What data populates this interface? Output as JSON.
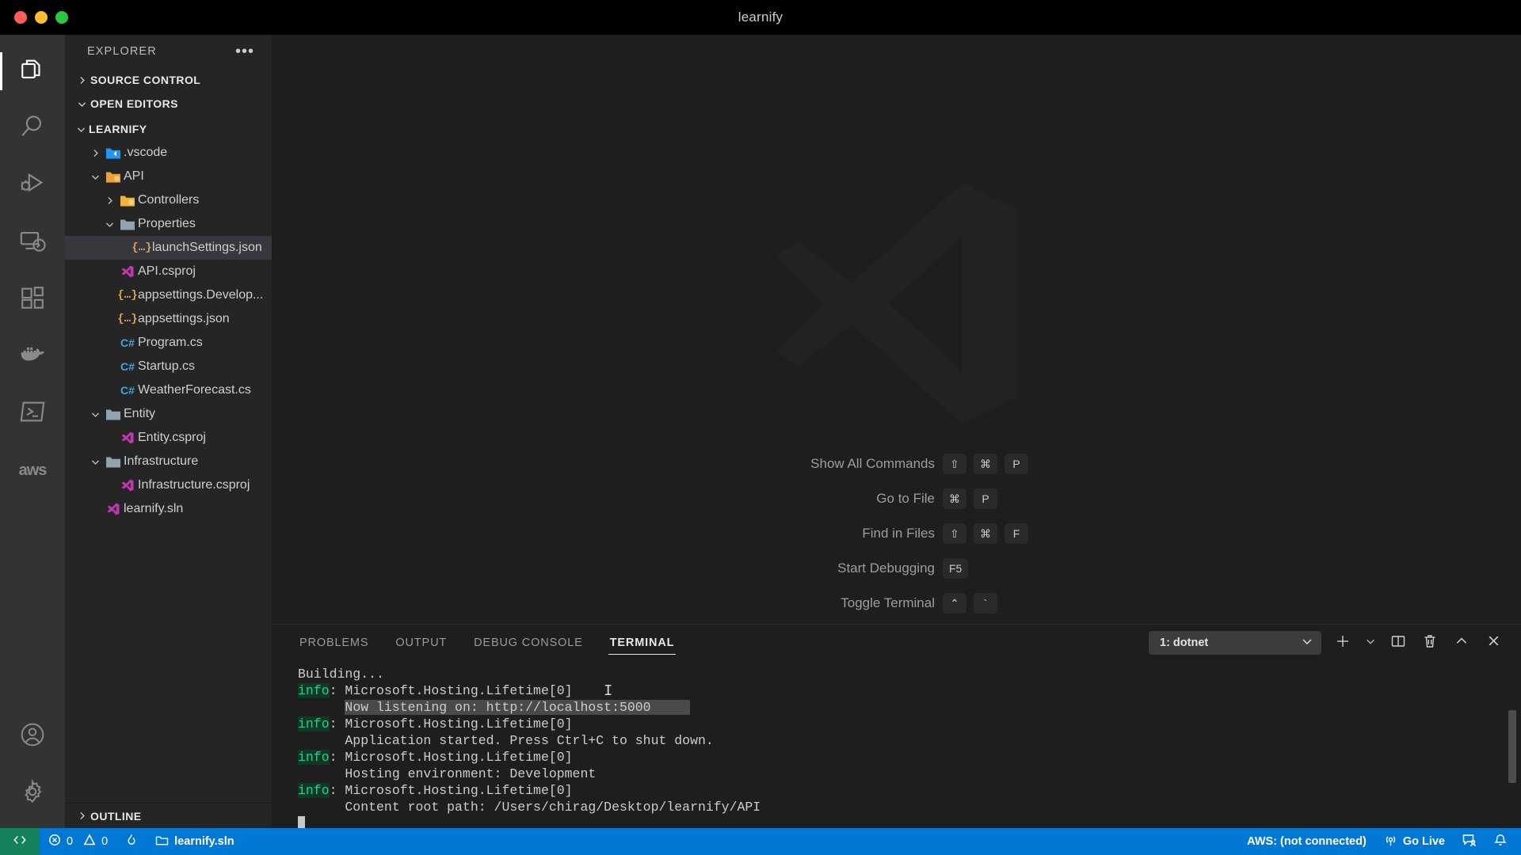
{
  "window": {
    "title": "learnify",
    "traffic_lights": [
      {
        "name": "close",
        "color": "#ff5f57"
      },
      {
        "name": "minimize",
        "color": "#febc2e"
      },
      {
        "name": "maximize",
        "color": "#28c840"
      }
    ]
  },
  "activitybar": {
    "items": [
      {
        "icon": "explorer-icon",
        "label": "Explorer",
        "active": true
      },
      {
        "icon": "search-icon",
        "label": "Search",
        "active": false
      },
      {
        "icon": "run-and-debug-icon",
        "label": "Run and Debug",
        "active": false
      },
      {
        "icon": "remote-explorer-icon",
        "label": "Remote Explorer",
        "active": false
      },
      {
        "icon": "extensions-icon",
        "label": "Extensions",
        "active": false
      },
      {
        "icon": "docker-icon",
        "label": "Docker",
        "active": false
      },
      {
        "icon": "terminal-powershell-icon",
        "label": "Azure Terminal",
        "active": false
      },
      {
        "icon": "aws-icon",
        "label": "aws",
        "active": false
      }
    ],
    "bottom_items": [
      {
        "icon": "account-icon",
        "label": "Accounts"
      },
      {
        "icon": "gear-icon",
        "label": "Manage"
      }
    ],
    "aws_text": "aws"
  },
  "sidebar": {
    "title": "EXPLORER",
    "more_actions": "•••",
    "sections": [
      {
        "label": "SOURCE CONTROL",
        "expanded": false
      },
      {
        "label": "OPEN EDITORS",
        "expanded": true
      }
    ],
    "outline_label": "OUTLINE",
    "tree": [
      {
        "label": "LEARNIFY",
        "indent": 0,
        "type": "root",
        "twisty": "down",
        "icon": "none",
        "selected": false,
        "bold": true
      },
      {
        "label": ".vscode",
        "indent": 1,
        "type": "folder",
        "twisty": "right",
        "icon": "folder-vscode-icon",
        "selected": false,
        "bold": false
      },
      {
        "label": "API",
        "indent": 1,
        "type": "folder",
        "twisty": "down",
        "icon": "folder-api-icon",
        "selected": false,
        "bold": false
      },
      {
        "label": "Controllers",
        "indent": 2,
        "type": "folder",
        "twisty": "right",
        "icon": "folder-controllers-icon",
        "selected": false,
        "bold": false
      },
      {
        "label": "Properties",
        "indent": 2,
        "type": "folder",
        "twisty": "down",
        "icon": "folder-properties-icon",
        "selected": false,
        "bold": false
      },
      {
        "label": "launchSettings.json",
        "indent": 3,
        "type": "file",
        "twisty": "none",
        "icon": "json-icon",
        "selected": true,
        "bold": false
      },
      {
        "label": "API.csproj",
        "indent": 2,
        "type": "file",
        "twisty": "none",
        "icon": "csproj-icon",
        "selected": false,
        "bold": false
      },
      {
        "label": "appsettings.Develop...",
        "indent": 2,
        "type": "file",
        "twisty": "none",
        "icon": "json-icon",
        "selected": false,
        "bold": false
      },
      {
        "label": "appsettings.json",
        "indent": 2,
        "type": "file",
        "twisty": "none",
        "icon": "json-icon",
        "selected": false,
        "bold": false
      },
      {
        "label": "Program.cs",
        "indent": 2,
        "type": "file",
        "twisty": "none",
        "icon": "csharp-icon",
        "selected": false,
        "bold": false
      },
      {
        "label": "Startup.cs",
        "indent": 2,
        "type": "file",
        "twisty": "none",
        "icon": "csharp-icon",
        "selected": false,
        "bold": false
      },
      {
        "label": "WeatherForecast.cs",
        "indent": 2,
        "type": "file",
        "twisty": "none",
        "icon": "csharp-icon",
        "selected": false,
        "bold": false
      },
      {
        "label": "Entity",
        "indent": 1,
        "type": "folder",
        "twisty": "down",
        "icon": "folder-icon",
        "selected": false,
        "bold": false
      },
      {
        "label": "Entity.csproj",
        "indent": 2,
        "type": "file",
        "twisty": "none",
        "icon": "csproj-icon",
        "selected": false,
        "bold": false
      },
      {
        "label": "Infrastructure",
        "indent": 1,
        "type": "folder",
        "twisty": "down",
        "icon": "folder-icon",
        "selected": false,
        "bold": false
      },
      {
        "label": "Infrastructure.csproj",
        "indent": 2,
        "type": "file",
        "twisty": "none",
        "icon": "csproj-icon",
        "selected": false,
        "bold": false
      },
      {
        "label": "learnify.sln",
        "indent": 1,
        "type": "file",
        "twisty": "none",
        "icon": "csproj-icon",
        "selected": false,
        "bold": false
      }
    ]
  },
  "welcome": {
    "logo": "vscode-logo-watermark",
    "shortcuts": [
      {
        "label": "Show All Commands",
        "keys": [
          "⇧",
          "⌘",
          "P"
        ]
      },
      {
        "label": "Go to File",
        "keys": [
          "⌘",
          "P"
        ]
      },
      {
        "label": "Find in Files",
        "keys": [
          "⇧",
          "⌘",
          "F"
        ]
      },
      {
        "label": "Start Debugging",
        "keys": [
          "F5"
        ]
      },
      {
        "label": "Toggle Terminal",
        "keys": [
          "⌃",
          "`"
        ]
      }
    ]
  },
  "panel": {
    "tabs": [
      {
        "label": "PROBLEMS",
        "active": false
      },
      {
        "label": "OUTPUT",
        "active": false
      },
      {
        "label": "DEBUG CONSOLE",
        "active": false
      },
      {
        "label": "TERMINAL",
        "active": true
      }
    ],
    "terminal_select": {
      "value": "1: dotnet",
      "chevron": "chevron-down-icon"
    },
    "actions": [
      {
        "icon": "new-terminal-icon",
        "label": "New Terminal"
      },
      {
        "icon": "chevron-down-icon",
        "label": "Terminal Profiles"
      },
      {
        "icon": "split-terminal-icon",
        "label": "Split Terminal"
      },
      {
        "icon": "trash-icon",
        "label": "Kill Terminal"
      },
      {
        "icon": "chevron-up-icon",
        "label": "Maximize Panel"
      },
      {
        "icon": "close-icon",
        "label": "Close Panel"
      }
    ],
    "terminal_lines": [
      {
        "segments": [
          {
            "text": "Building...",
            "style": "plain"
          }
        ]
      },
      {
        "segments": [
          {
            "text": "info",
            "style": "info"
          },
          {
            "text": ": Microsoft.Hosting.Lifetime[0]",
            "style": "plain"
          }
        ]
      },
      {
        "segments": [
          {
            "text": "      ",
            "style": "plain"
          },
          {
            "text": "Now listening on: http://localhost:5000     ",
            "style": "selected"
          }
        ]
      },
      {
        "segments": [
          {
            "text": "info",
            "style": "info"
          },
          {
            "text": ": Microsoft.Hosting.Lifetime[0]",
            "style": "plain"
          }
        ]
      },
      {
        "segments": [
          {
            "text": "      Application started. Press Ctrl+C to shut down.",
            "style": "plain"
          }
        ]
      },
      {
        "segments": [
          {
            "text": "info",
            "style": "info"
          },
          {
            "text": ": Microsoft.Hosting.Lifetime[0]",
            "style": "plain"
          }
        ]
      },
      {
        "segments": [
          {
            "text": "      Hosting environment: Development",
            "style": "plain"
          }
        ]
      },
      {
        "segments": [
          {
            "text": "info",
            "style": "info"
          },
          {
            "text": ": Microsoft.Hosting.Lifetime[0]",
            "style": "plain"
          }
        ]
      },
      {
        "segments": [
          {
            "text": "      Content root path: /Users/chirag/Desktop/learnify/API",
            "style": "plain"
          }
        ]
      },
      {
        "segments": [
          {
            "text": "",
            "style": "cursor"
          }
        ]
      }
    ]
  },
  "statusbar": {
    "remote_label": "remote-indicator-icon",
    "errors": "0",
    "warnings": "0",
    "radon_icon": "flame-icon",
    "solution": "learnify.sln",
    "aws_status": "AWS: (not connected)",
    "go_live": "Go Live",
    "right_icons": [
      "feedback-icon",
      "bell-icon"
    ],
    "colors": {
      "background": "#0078d4",
      "remote": "#16825d"
    }
  }
}
